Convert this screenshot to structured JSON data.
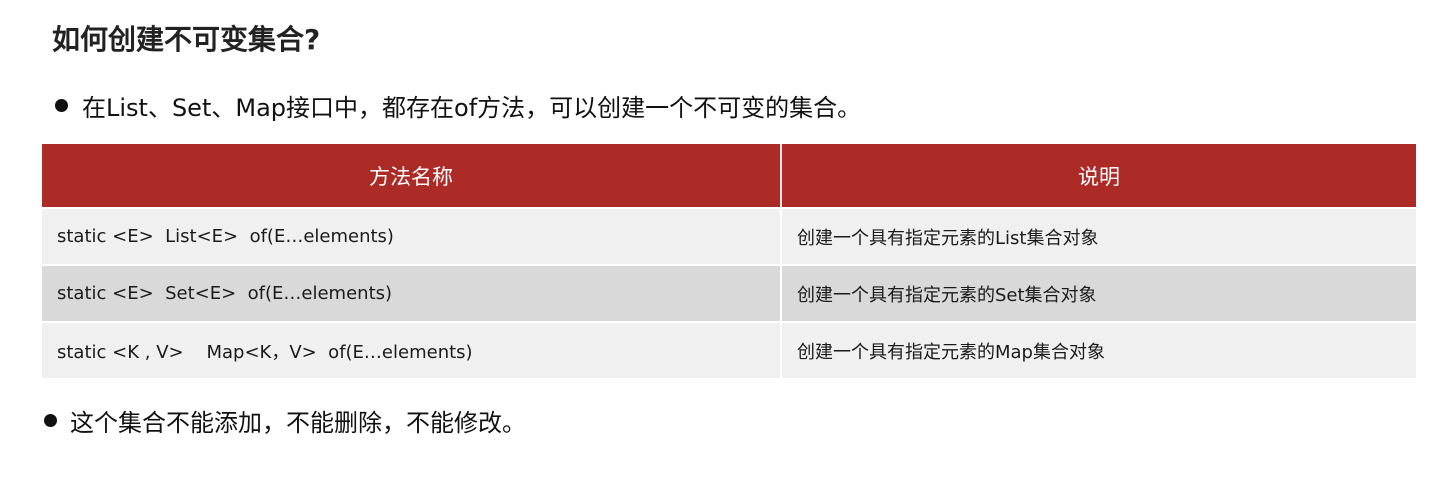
{
  "title": "如何创建不可变集合?",
  "bullets": [
    "在List、Set、Map接口中，都存在of方法，可以创建一个不可变的集合。",
    "这个集合不能添加，不能删除，不能修改。"
  ],
  "table": {
    "headers": [
      "方法名称",
      "说明"
    ],
    "rows": [
      {
        "method": "static <E>  List<E>  of(E…elements)",
        "desc": "创建一个具有指定元素的List集合对象"
      },
      {
        "method": "static <E>  Set<E>  of(E…elements)",
        "desc": "创建一个具有指定元素的Set集合对象"
      },
      {
        "method": "static <K , V>    Map<K，V>  of(E…elements)",
        "desc": "创建一个具有指定元素的Map集合对象"
      }
    ]
  },
  "colors": {
    "header_bg": "#ac2b27",
    "row_light": "#f0f0f0",
    "row_dark": "#d9d9d9"
  }
}
